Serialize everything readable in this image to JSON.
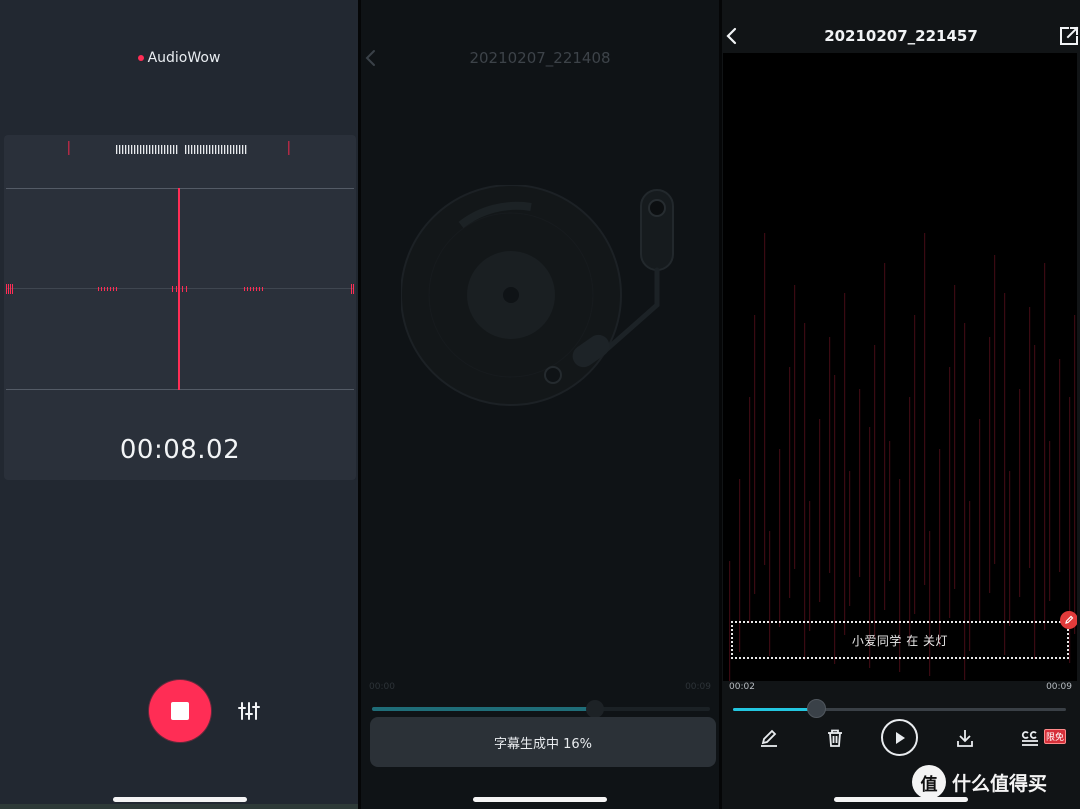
{
  "recorder": {
    "brand": "AudioWow",
    "timer": "00:08.02",
    "accent": "#ff2d55",
    "icons": {
      "stop": "stop-icon",
      "equalizer": "equalizer-icon"
    }
  },
  "converter": {
    "title": "20210207_221408",
    "time_start": "00:00",
    "time_end": "00:09",
    "progress": 0.66,
    "toast": "字幕生成中 16%",
    "icons": {
      "back": "chevron-left-icon",
      "art": "turntable-icon"
    }
  },
  "player": {
    "title": "20210207_221457",
    "subtitle_text": "小爱同学 在  关灯",
    "time_start": "00:02",
    "time_end": "00:09",
    "progress": 0.25,
    "free_badge": "限免",
    "accent": "#23c7e0",
    "icons": {
      "back": "chevron-left-icon",
      "share": "share-icon",
      "edit": "pen-icon",
      "delete": "trash-icon",
      "play": "play-icon",
      "download": "download-icon",
      "subtitles": "subtitle-icon"
    }
  },
  "watermark": {
    "logo_char": "值",
    "text": "什么值得买"
  }
}
